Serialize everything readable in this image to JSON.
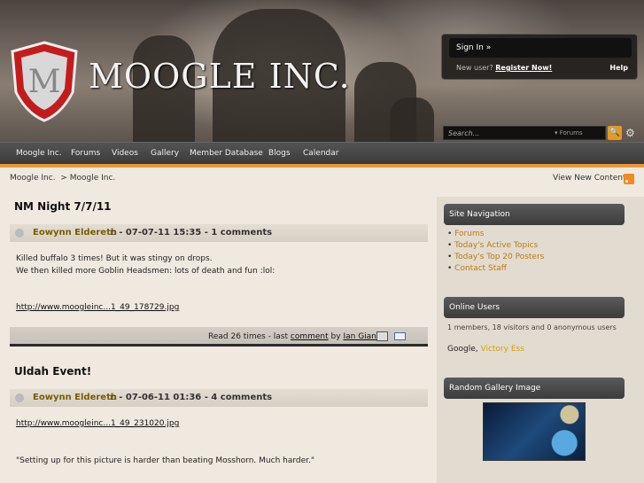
{
  "header": {
    "logo_letter": "M",
    "site_name": "MOOGLE INC.",
    "signin_label": "Sign In »",
    "new_user_text": "New user?",
    "register_label": "Register Now!",
    "help_label": "Help",
    "search_placeholder": "Search...",
    "search_scope": "Forums",
    "search_button": "🔍",
    "gear_glyph": "⚙"
  },
  "nav": {
    "items": [
      "Moogle Inc.",
      "Forums",
      "Videos",
      "Gallery",
      "Member Database",
      "Blogs",
      "Calendar"
    ]
  },
  "breadcrumb": {
    "root": "Moogle Inc.",
    "sep": ">",
    "current": "Moogle Inc.",
    "new_content": "View New Content"
  },
  "posts": [
    {
      "title": "NM Night 7/7/11",
      "author": "Eowynn Eldereth",
      "meta": "- 07-07-11 15:35 - 1 comments",
      "body": [
        "Killed buffalo 3 times! But it was stingy on drops.",
        "We then killed more Goblin Headsmen: lots of death and fun :lol:"
      ],
      "link": "http://www.moogleinc...1_49_178729.jpg",
      "read_prefix": "Read 26 times - last",
      "comment_label": "comment",
      "by": "by",
      "last_by": "Ian Giant"
    },
    {
      "title": "Uldah Event!",
      "author": "Eowynn Eldereth",
      "meta": "- 07-06-11 01:36 - 4 comments",
      "link": "http://www.moogleinc...1_49_231020.jpg",
      "quote": "\"Setting up for this picture is harder than beating Mosshorn. Much harder.\""
    }
  ],
  "sidebar": {
    "nav_title": "Site Navigation",
    "nav_items": [
      "Forums",
      "Today's Active Topics",
      "Today's Top 20 Posters",
      "Contact Staff"
    ],
    "online_title": "Online Users",
    "online_summary": "1 members, 18 visitors and 0 anonymous users",
    "online_bot": "Google,",
    "online_member": "Victory Ess",
    "gallery_title": "Random Gallery Image"
  }
}
